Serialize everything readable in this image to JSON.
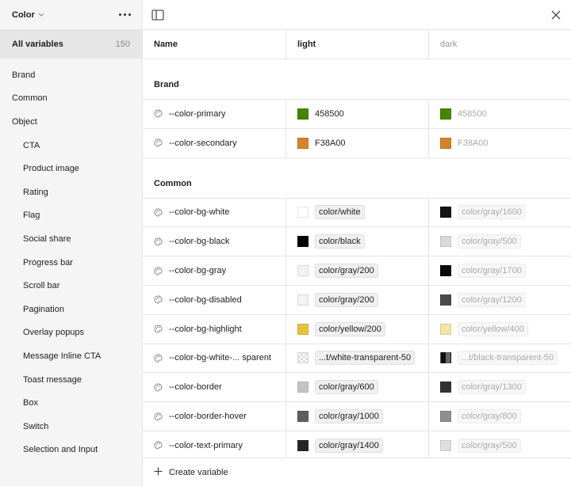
{
  "sidebar": {
    "collection_title": "Color",
    "all_label": "All variables",
    "all_count": "150",
    "items": [
      {
        "label": "Brand"
      },
      {
        "label": "Common"
      },
      {
        "label": "Object"
      },
      {
        "label": "CTA"
      },
      {
        "label": "Product image"
      },
      {
        "label": "Rating"
      },
      {
        "label": "Flag"
      },
      {
        "label": "Social share"
      },
      {
        "label": "Progress bar"
      },
      {
        "label": "Scroll bar"
      },
      {
        "label": "Pagination"
      },
      {
        "label": "Overlay popups"
      },
      {
        "label": "Message Inline CTA"
      },
      {
        "label": "Toast message"
      },
      {
        "label": "Box"
      },
      {
        "label": "Switch"
      },
      {
        "label": "Selection and Input"
      }
    ]
  },
  "table": {
    "col_name": "Name",
    "col_light": "light",
    "col_dark": "dark",
    "groups": [
      {
        "label": "Brand",
        "rows": [
          {
            "name": "--color-primary",
            "light": {
              "text": "458500",
              "color": "#458500"
            },
            "dark": {
              "text": "458500",
              "color": "#458500"
            }
          },
          {
            "name": "--color-secondary",
            "light": {
              "text": "F38A00",
              "color": "#D3832A"
            },
            "dark": {
              "text": "F38A00",
              "color": "#D3832A"
            }
          }
        ]
      },
      {
        "label": "Common",
        "rows": [
          {
            "name": "--color-bg-white",
            "light": {
              "text": "color/white",
              "color": "#ffffff"
            },
            "dark": {
              "text": "color/gray/1600",
              "color": "#141414"
            }
          },
          {
            "name": "--color-bg-black",
            "light": {
              "text": "color/black",
              "color": "#000000"
            },
            "dark": {
              "text": "color/gray/500",
              "color": "#d9d9d9"
            }
          },
          {
            "name": "--color-bg-gray",
            "light": {
              "text": "color/gray/200",
              "color": "#f3f3f3"
            },
            "dark": {
              "text": "color/gray/1700",
              "color": "#0a0a0a"
            }
          },
          {
            "name": "--color-bg-disabled",
            "light": {
              "text": "color/gray/200",
              "color": "#f3f3f3"
            },
            "dark": {
              "text": "color/gray/1200",
              "color": "#4a4a4a"
            }
          },
          {
            "name": "--color-bg-highlight",
            "light": {
              "text": "color/yellow/200",
              "color": "#e8c23c"
            },
            "dark": {
              "text": "color/yellow/400",
              "color": "#efe6a8"
            }
          },
          {
            "name": "--color-bg-white-... sparent",
            "light": {
              "text": "...t/white-transparent-50",
              "color": "checker"
            },
            "dark": {
              "text": "...t/black-transparent-50",
              "color": "half-black"
            }
          },
          {
            "name": "--color-border",
            "light": {
              "text": "color/gray/600",
              "color": "#c4c4c4"
            },
            "dark": {
              "text": "color/gray/1300",
              "color": "#333333"
            }
          },
          {
            "name": "--color-border-hover",
            "light": {
              "text": "color/gray/1000",
              "color": "#5e5e5e"
            },
            "dark": {
              "text": "color/gray/800",
              "color": "#8f8f8f"
            }
          },
          {
            "name": "--color-text-primary",
            "light": {
              "text": "color/gray/1400",
              "color": "#262626"
            },
            "dark": {
              "text": "color/gray/500",
              "color": "#dedede"
            }
          }
        ]
      }
    ]
  },
  "footer": {
    "create_label": "Create variable"
  }
}
